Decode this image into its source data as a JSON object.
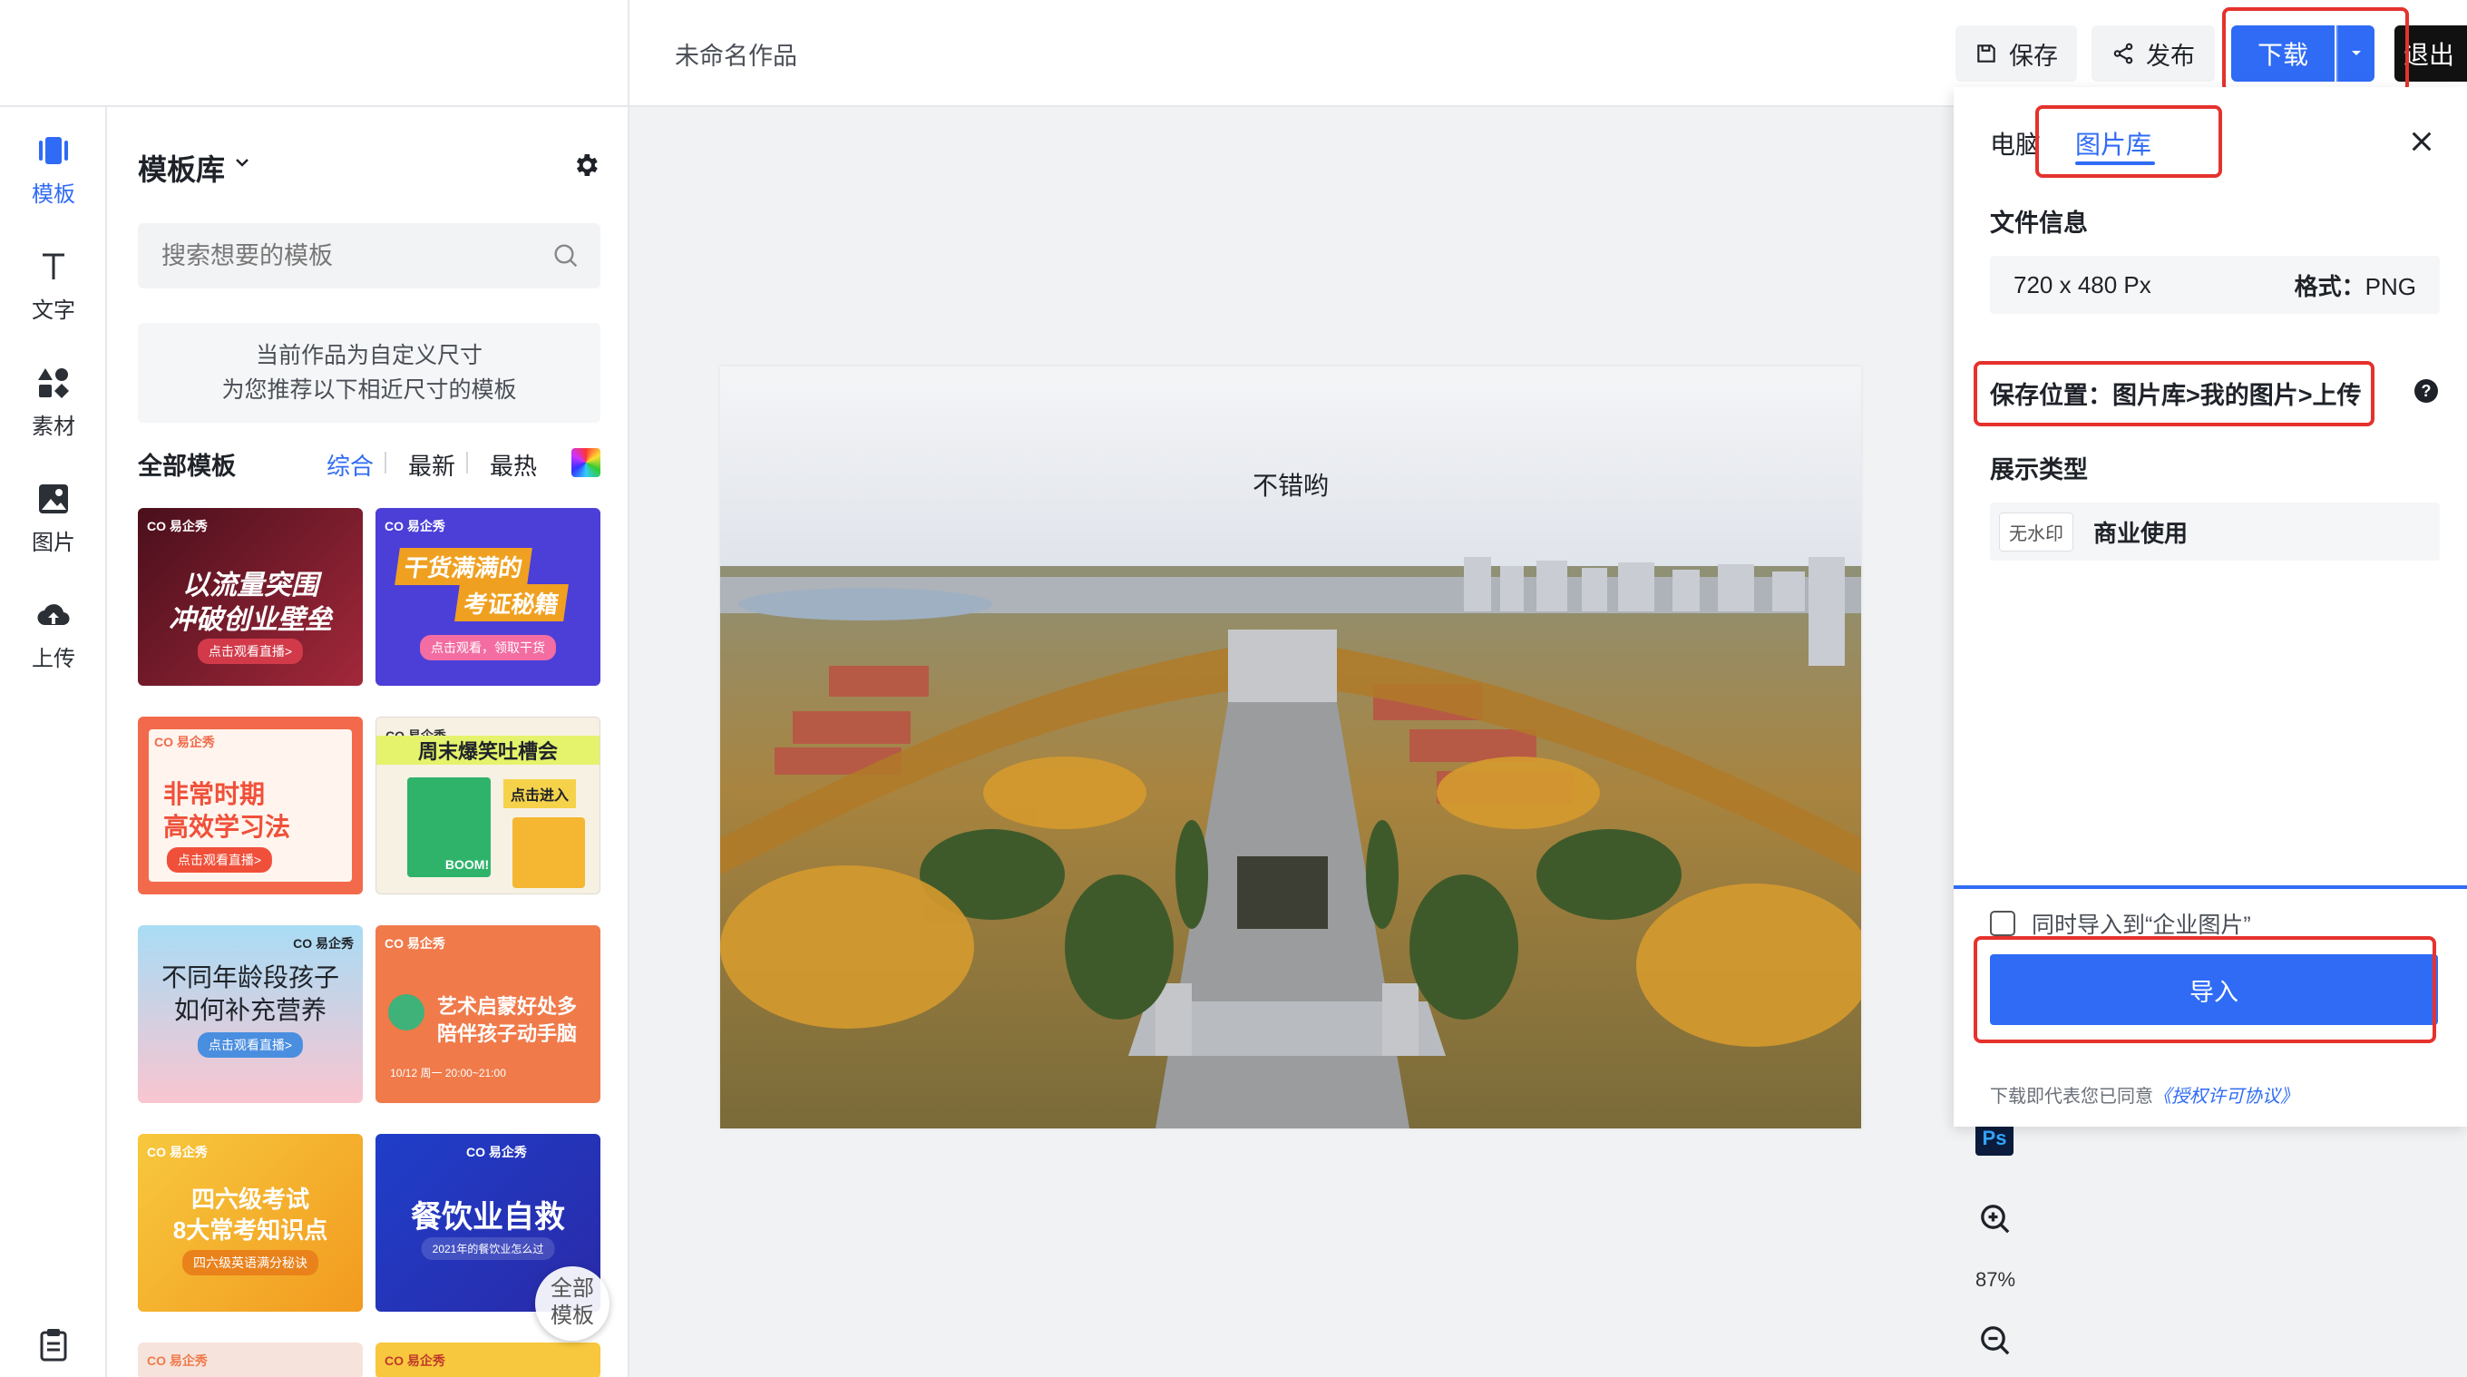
{
  "topbar": {
    "doc_title": "未命名作品",
    "save_label": "保存",
    "publish_label": "发布",
    "download_label": "下载",
    "exit_label": "退出"
  },
  "rail": {
    "items": [
      {
        "label": "模板",
        "icon": "template-icon"
      },
      {
        "label": "文字",
        "icon": "text-icon"
      },
      {
        "label": "素材",
        "icon": "material-icon"
      },
      {
        "label": "图片",
        "icon": "image-icon"
      },
      {
        "label": "上传",
        "icon": "upload-icon"
      }
    ]
  },
  "template_panel": {
    "title": "模板库",
    "search_placeholder": "搜索想要的模板",
    "notice_line1": "当前作品为自定义尺寸",
    "notice_line2": "为您推荐以下相近尺寸的模板",
    "all_templates": "全部模板",
    "sort_options": [
      "综合",
      "最新",
      "最热"
    ],
    "all_templates_button": [
      "全部",
      "模板"
    ],
    "cards": [
      {
        "title1": "以流量突围",
        "title2": "冲破创业壁垒",
        "pill": "点击观看直播>",
        "bg": "#7a1e2e"
      },
      {
        "title1": "干货满满的",
        "title2": "考证秘籍",
        "pill": "点击观看，领取干货",
        "bg": "#4b3fd8"
      },
      {
        "title1": "非常时期",
        "title2": "高效学习法",
        "pill": "点击观看直播>",
        "bg": "#f26a4b"
      },
      {
        "title1": "周末爆笑吐槽会",
        "title2": "点击进入",
        "pill": "BOOM!",
        "bg": "#f6f1e3"
      },
      {
        "title1": "不同年龄段孩子",
        "title2": "如何补充营养",
        "pill": "点击观看直播>",
        "bg": "#9ed3f0"
      },
      {
        "title1": "艺术启蒙好处多",
        "title2": "陪伴孩子动手脑",
        "pill": "10/12 周一 20:00~21:00",
        "bg": "#f07a4a"
      },
      {
        "title1": "四六级考试",
        "title2": "8大常考知识点",
        "pill": "四六级英语满分秘诀",
        "bg": "#f5b731"
      },
      {
        "title1": "餐饮业自救",
        "title2": "2021年的餐饮业怎么过",
        "pill": "",
        "bg": "#1f3ec9"
      }
    ]
  },
  "canvas": {
    "caption": "不错哟",
    "zoom": "87%"
  },
  "export_panel": {
    "tab_computer": "电脑",
    "tab_library": "图片库",
    "file_info_label": "文件信息",
    "dimensions": "720 x 480 Px",
    "format_label": "格式：",
    "format_value": "PNG",
    "save_location": "保存位置：图片库>我的图片>上传",
    "display_type_label": "展示类型",
    "watermark_badge": "无水印",
    "usage": "商业使用",
    "also_import": "同时导入到“企业图片”",
    "import_button": "导入",
    "agreement_prefix": "下载即代表您已同意",
    "agreement_link": "《授权许可协议》"
  },
  "colors": {
    "accent": "#2f6bf5",
    "highlight_box": "#e5322d"
  }
}
